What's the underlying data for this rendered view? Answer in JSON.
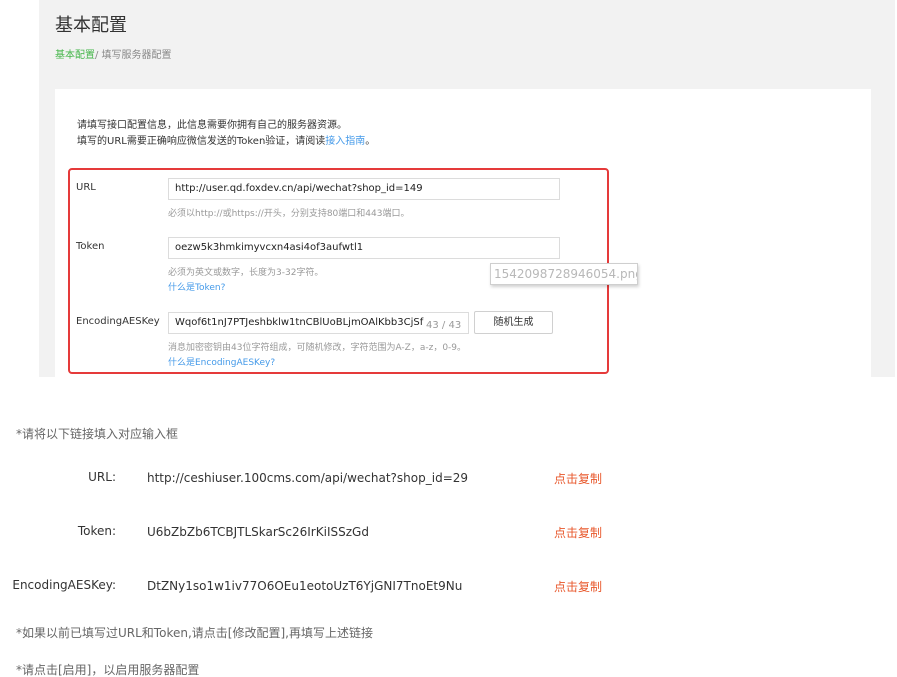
{
  "page": {
    "title": "基本配置",
    "breadcrumb_active": "基本配置",
    "breadcrumb_rest": "/ 填写服务器配置"
  },
  "intro": {
    "line1": "请填写接口配置信息，此信息需要你拥有自己的服务器资源。",
    "line2_prefix": "填写的URL需要正确响应微信发送的Token验证，请阅读",
    "line2_link": "接入指南",
    "line2_suffix": "。"
  },
  "form": {
    "url": {
      "label": "URL",
      "value": "http://user.qd.foxdev.cn/api/wechat?shop_id=149",
      "hint": "必须以http://或https://开头，分别支持80端口和443端口。"
    },
    "token": {
      "label": "Token",
      "value": "oezw5k3hmkimyvcxn4asi4of3aufwtl1",
      "hint": "必须为英文或数字，长度为3-32字符。",
      "link": "什么是Token?"
    },
    "aes": {
      "label": "EncodingAESKey",
      "value": "Wqof6t1nJ7PTJeshbklw1tnCBlUoBLjmOAlKbb3CjSf",
      "counter": "43 / 43",
      "button": "随机生成",
      "hint": "消息加密密钥由43位字符组成，可随机修改，字符范围为A-Z，a-z，0-9。",
      "link": "什么是EncodingAESKey?"
    }
  },
  "tooltip": "1542098728946054.png",
  "instructions": {
    "intro": "*请将以下链接填入对应输入框",
    "rows": [
      {
        "label": "URL:",
        "value": "http://ceshiuser.100cms.com/api/wechat?shop_id=29",
        "action": "点击复制"
      },
      {
        "label": "Token:",
        "value": "U6bZbZb6TCBJTLSkarSc26IrKiISSzGd",
        "action": "点击复制"
      },
      {
        "label": "EncodingAESKey:",
        "value": "DtZNy1so1w1iv77O6OEu1eotoUzT6YjGNI7TnoEt9Nu",
        "action": "点击复制"
      }
    ],
    "note1": "*如果以前已填写过URL和Token,请点击[修改配置],再填写上述链接",
    "note2": "*请点击[启用]，以启用服务器配置"
  },
  "colors": {
    "highlight_border": "#e53a3a",
    "breadcrumb_active": "#44b549",
    "link": "#459ae9",
    "copy_action": "#e8582c"
  }
}
